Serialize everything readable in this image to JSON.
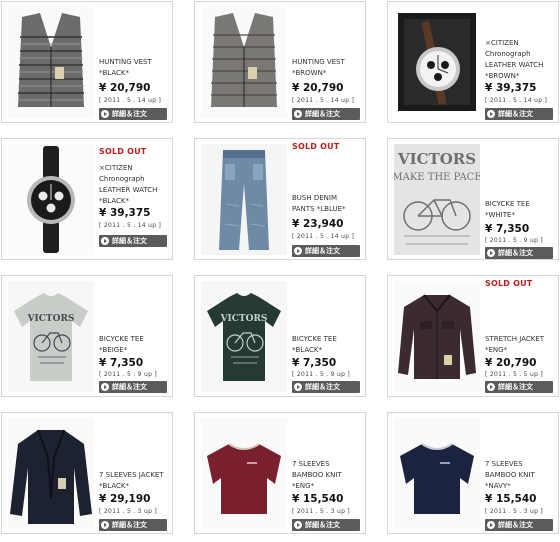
{
  "products": [
    {
      "sold_out": "",
      "name": "HUNTING VEST\n*BLACK*",
      "price": "¥ 20,790",
      "date": "[ 2011 . 5 . 14 up ]",
      "button": "詳細＆注文"
    },
    {
      "sold_out": "",
      "name": "HUNTING VEST\n*BROWN*",
      "price": "¥ 20,790",
      "date": "[ 2011 . 5 . 14 up ]",
      "button": "詳細＆注文"
    },
    {
      "sold_out": "",
      "name": "×CITIZEN\nChronograph\nLEATHER WATCH\n*BROWN*",
      "price": "¥ 39,375",
      "date": "[ 2011 . 5 . 14 up ]",
      "button": "詳細＆注文"
    },
    {
      "sold_out": "SOLD OUT",
      "name": "×CITIZEN\nChronograph\nLEATHER WATCH\n*BLACK*",
      "price": "¥ 39,375",
      "date": "[ 2011 . 5 . 14 up ]",
      "button": "詳細＆注文"
    },
    {
      "sold_out": "SOLD OUT",
      "name": "BUSH DENIM\nPANTS *LBLUE*",
      "price": "¥ 23,940",
      "date": "[ 2011 . 5 . 14 up ]",
      "button": "詳細＆注文"
    },
    {
      "sold_out": "",
      "name": "BICYCKE TEE\n*WHITE*",
      "price": "¥ 7,350",
      "date": "[ 2011 . 5 . 9 up ]",
      "button": "詳細＆注文"
    },
    {
      "sold_out": "",
      "name": "BICYCKE TEE\n*BEIGE*",
      "price": "¥ 7,350",
      "date": "[ 2011 . 5 . 9 up ]",
      "button": "詳細＆注文"
    },
    {
      "sold_out": "",
      "name": "BICYCKE TEE\n*BLACK*",
      "price": "¥ 7,350",
      "date": "[ 2011 . 5 . 9 up ]",
      "button": "詳細＆注文"
    },
    {
      "sold_out": "SOLD OUT",
      "name": "STRETCH JACKET\n*ENG*",
      "price": "¥ 20,790",
      "date": "[ 2011 . 5 . 5 up ]",
      "button": "詳細＆注文"
    },
    {
      "sold_out": "",
      "name": "7 SLEEVES JACKET\n*BLACK*",
      "price": "¥ 29,190",
      "date": "[ 2011 . 5 . 3 up ]",
      "button": "詳細＆注文"
    },
    {
      "sold_out": "",
      "name": "7 SLEEVES\nBAMBOO KNIT\n*ENG*",
      "price": "¥ 15,540",
      "date": "[ 2011 . 5 . 3 up ]",
      "button": "詳細＆注文"
    },
    {
      "sold_out": "",
      "name": "7 SLEEVES\nBAMBOO KNIT\n*NAVY*",
      "price": "¥ 15,540",
      "date": "[ 2011 . 5 . 3 up ]",
      "button": "詳細＆注文"
    }
  ],
  "thumb_labels": {
    "victors": "VICTORS",
    "make_the_pace": "MAKE THE PACE"
  },
  "colors": {
    "sold_out": "#b8201e",
    "button_bg": "#5b5b5b",
    "border": "#d6d6d6"
  }
}
